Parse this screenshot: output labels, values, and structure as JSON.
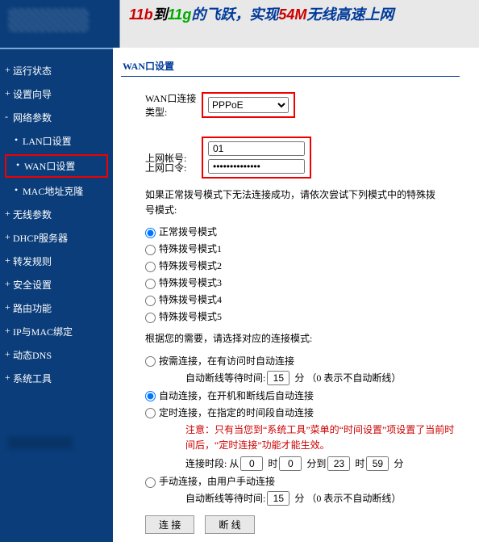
{
  "banner": {
    "t11b": "11b",
    "to": "到",
    "t11g": "11g",
    "fy": "的飞跃，实现",
    "t54m": "54M",
    "rest": "无线高速上网"
  },
  "sidebar": {
    "items": [
      {
        "label": "运行状态",
        "type": "top"
      },
      {
        "label": "设置向导",
        "type": "top"
      },
      {
        "label": "网络参数",
        "type": "top open"
      },
      {
        "label": "LAN口设置",
        "type": "sub"
      },
      {
        "label": "WAN口设置",
        "type": "sub hl"
      },
      {
        "label": "MAC地址克隆",
        "type": "sub"
      },
      {
        "label": "无线参数",
        "type": "top"
      },
      {
        "label": "DHCP服务器",
        "type": "top"
      },
      {
        "label": "转发规则",
        "type": "top"
      },
      {
        "label": "安全设置",
        "type": "top"
      },
      {
        "label": "路由功能",
        "type": "top"
      },
      {
        "label": "IP与MAC绑定",
        "type": "top"
      },
      {
        "label": "动态DNS",
        "type": "top"
      },
      {
        "label": "系统工具",
        "type": "top"
      }
    ]
  },
  "main": {
    "panel_title": "WAN口设置",
    "conn_type_label": "WAN口连接类型:",
    "conn_type_value": "PPPoE",
    "user_label": "上网帐号:",
    "user_value": "01",
    "pass_label": "上网口令:",
    "pass_value": "••••••••••••••",
    "dial_note": "如果正常拨号模式下无法连接成功，请依次尝试下列模式中的特殊拨号模式:",
    "dial_modes": {
      "normal": "正常拨号模式",
      "sp1": "特殊拨号模式1",
      "sp2": "特殊拨号模式2",
      "sp3": "特殊拨号模式3",
      "sp4": "特殊拨号模式4",
      "sp5": "特殊拨号模式5"
    },
    "conn_mode_note": "根据您的需要，请选择对应的连接模式:",
    "conn_modes": {
      "demand": "按需连接，在有访问时自动连接",
      "demand_wait_pre": "自动断线等待时间:",
      "demand_wait_val": "15",
      "demand_wait_suf": "分  （0 表示不自动断线）",
      "auto": "自动连接，在开机和断线后自动连接",
      "timed": "定时连接，在指定的时间段自动连接",
      "timed_note": "注意：只有当您到“系统工具”菜单的“时间设置”项设置了当前时间后，“定时连接”功能才能生效。",
      "timed_pre": "连接时段: 从",
      "timed_h1": "0",
      "timed_hlbl": "时",
      "timed_m1": "0",
      "timed_mlbl": "分到",
      "timed_h2": "23",
      "timed_m2": "59",
      "timed_suf": "分",
      "manual": "手动连接，由用户手动连接",
      "manual_wait_pre": "自动断线等待时间:",
      "manual_wait_val": "15",
      "manual_wait_suf": "分  （0 表示不自动断线）"
    },
    "btn_connect": "连 接",
    "btn_disconnect": "断 线"
  }
}
